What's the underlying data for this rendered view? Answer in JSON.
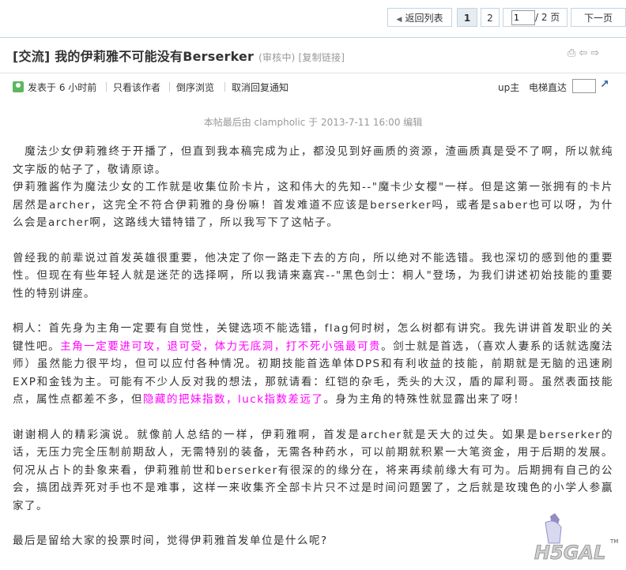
{
  "nav": {
    "back_label": "返回列表",
    "page1": "1",
    "page2": "2",
    "page_input": "1",
    "page_total": "/ 2 页",
    "next_label": "下一页"
  },
  "thread": {
    "title": "[交流] 我的伊莉雅不可能没有Berserker",
    "status": "(审核中)",
    "copy_link": "[复制链接]"
  },
  "author_bar": {
    "posted": "发表于 6 小时前",
    "only_author": "只看该作者",
    "reverse": "倒序浏览",
    "cancel_notify": "取消回复通知",
    "up": "up主",
    "elevator": "电梯直达"
  },
  "edit_note": "本帖最后由 clampholic 于 2013-7-11 16:00 编辑",
  "content": {
    "p1": "　魔法少女伊莉雅终于开播了，但直到我本稿完成为止，都没见到好画质的资源，渣画质真是受不了啊，所以就纯文字版的帖子了，敬请原谅。",
    "p1b": "伊莉雅酱作为魔法少女的工作就是收集位阶卡片，这和伟大的先知--\"魔卡少女樱\"一样。但是这第一张拥有的卡片居然是archer，这完全不符合伊莉雅的身份嘛！首发难道不应该是berserker吗，或者是saber也可以呀，为什么会是archer啊，这路线大错特错了，所以我写下了这帖子。",
    "p2": "曾经我的前辈说过首发英雄很重要，他决定了你一路走下去的方向，所以绝对不能选错。我也深切的感到他的重要性。但现在有些年轻人就是迷茫的选择啊，所以我请来嘉宾--\"黑色剑士：桐人\"登场，为我们讲述初始技能的重要性的特别讲座。",
    "p3a": "桐人：首先身为主角一定要有自觉性，关键选项不能选错，flag何时树，怎么树都有讲究。我先讲讲首发职业的关键性吧。",
    "p3hl1": "主角一定要进可攻，退可受，体力无底洞，打不死小强最可贵",
    "p3b": "。剑士就是首选，（喜欢人妻系的话就选魔法师）虽然能力很平均，但可以应付各种情况。初期技能首选单体DPS和有利收益的技能，前期就是无脑的迅速刷EXP和金钱为主。可能有不少人反对我的想法，那就请看：红铠的杂毛，秃头的大汉，盾的犀利哥。虽然表面技能点，属性点都差不多，但",
    "p3hl2": "隐藏的把妹指数，luck指数差远了",
    "p3c": "。身为主角的特殊性就显露出来了呀！",
    "p4": "谢谢桐人的精彩演说。就像前人总结的一样，伊莉雅啊，首发是archer就是天大的过失。如果是berserker的话，无压力完全压制前期敌人，无需特别的装备，无需各种药水，可以前期就积累一大笔资金，用于后期的发展。何况从占卜的卦象来看，伊莉雅前世和berserker有很深的的缘分在，将来再续前缘大有可为。后期拥有自己的公会，搞团战弄死对手也不是难事，这样一来收集齐全部卡片只不过是时间问题罢了，之后就是玫瑰色的小学人参赢家了。",
    "p5": "最后是留给大家的投票时间，觉得伊莉雅首发单位是什么呢?"
  },
  "watermark": "H5GAL",
  "watermark_tm": "TM",
  "colors": {
    "highlight": "#ff00ff",
    "border": "#c2d5e3"
  }
}
